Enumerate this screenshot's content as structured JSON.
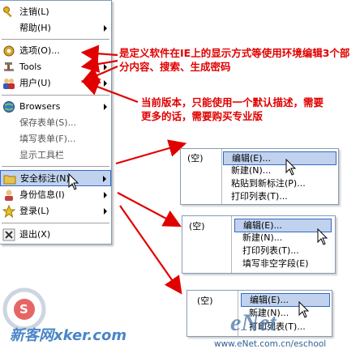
{
  "menu": {
    "items": [
      {
        "label": "注销(L)",
        "icon": "key-icon",
        "arrow": false
      },
      {
        "label": "帮助(H)",
        "icon": "help-icon",
        "arrow": true
      },
      {
        "label": "选项(O)...",
        "icon": "gear-icon",
        "arrow": false
      },
      {
        "label": "Tools",
        "icon": "tools-icon",
        "arrow": true
      },
      {
        "label": "用户(U)",
        "icon": "users-icon",
        "arrow": true
      },
      {
        "label": "Browsers",
        "icon": "globe-icon",
        "arrow": true
      },
      {
        "label": "保存表单(S)...",
        "icon": "",
        "arrow": false
      },
      {
        "label": "填写表单(F)...",
        "icon": "",
        "arrow": false
      },
      {
        "label": "显示工具栏",
        "icon": "",
        "arrow": false
      },
      {
        "label": "安全标注(N)",
        "icon": "folder-icon",
        "arrow": true
      },
      {
        "label": "身份信息(I)",
        "icon": "identity-icon",
        "arrow": true
      },
      {
        "label": "登录(L)",
        "icon": "login-star-icon",
        "arrow": true
      },
      {
        "label": "退出(X)",
        "icon": "close-icon",
        "arrow": false
      }
    ]
  },
  "annotations": {
    "options_note": "是定义软件在IE上的显示方式等使用环境编辑3个部分内容、搜索、生成密码",
    "version_note": "当前版本，只能使用一个默认描述，需要更多的话，需要购买专业版"
  },
  "submenus": [
    {
      "empty": "(空)",
      "items": [
        "编辑(E)...",
        "新建(N)...",
        "粘贴到新标注(P)...",
        "打印列表(T)..."
      ]
    },
    {
      "empty": "(空)",
      "items": [
        "编辑(E)...",
        "新建(N)...",
        "打印列表(T)...",
        "填写非空字段(E)"
      ]
    },
    {
      "empty": "(空)",
      "items": [
        "编辑(E)...",
        "新建(N)...",
        "打印列表(T)..."
      ]
    }
  ],
  "watermarks": {
    "left": "新客网xker.com",
    "right_logo": "eNet",
    "right_url": "www.eNet.com.cn/eschool"
  },
  "colors": {
    "annotation": "#e10000",
    "highlight": "#c1d2ee",
    "highlight_border": "#316ac5"
  }
}
